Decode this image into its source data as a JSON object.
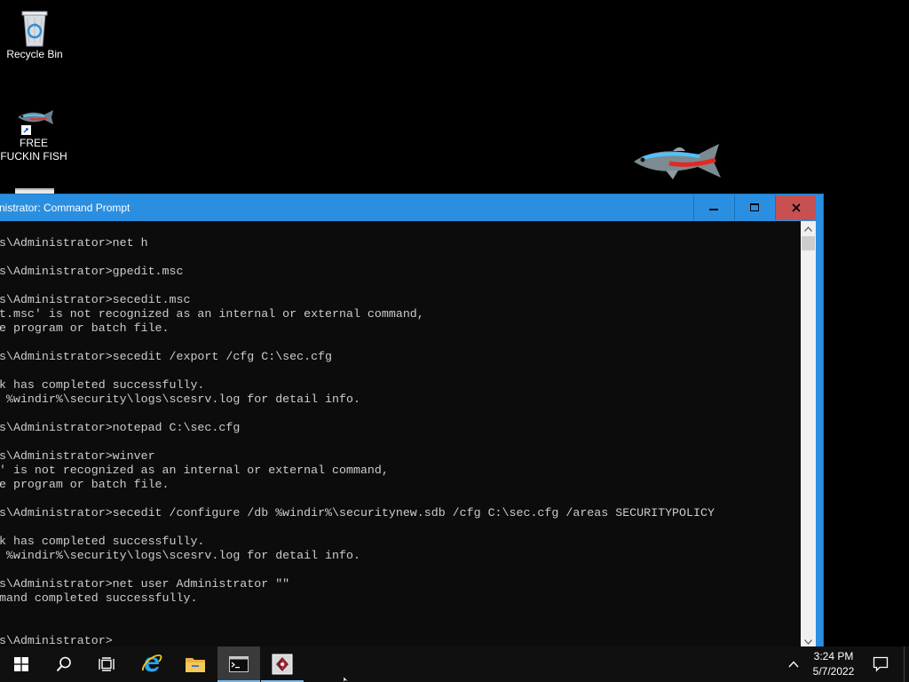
{
  "desktop": {
    "icons": [
      {
        "label": "Recycle Bin",
        "icon": "recycle-bin-icon"
      },
      {
        "label": "FREE FUCKIN FISH",
        "icon": "fish-shortcut-icon"
      }
    ]
  },
  "cmd_window": {
    "title": "nistrator: Command Prompt",
    "buttons": {
      "minimize": "minimize-icon",
      "maximize": "maximize-icon",
      "close": "close-icon"
    },
    "lines": [
      "s\\Administrator>net h",
      "",
      "s\\Administrator>gpedit.msc",
      "",
      "s\\Administrator>secedit.msc",
      "t.msc' is not recognized as an internal or external command,",
      "e program or batch file.",
      "",
      "s\\Administrator>secedit /export /cfg C:\\sec.cfg",
      "",
      "k has completed successfully.",
      " %windir%\\security\\logs\\scesrv.log for detail info.",
      "",
      "s\\Administrator>notepad C:\\sec.cfg",
      "",
      "s\\Administrator>winver",
      "' is not recognized as an internal or external command,",
      "e program or batch file.",
      "",
      "s\\Administrator>secedit /configure /db %windir%\\securitynew.sdb /cfg C:\\sec.cfg /areas SECURITYPOLICY",
      "",
      "k has completed successfully.",
      " %windir%\\security\\logs\\scesrv.log for detail info.",
      "",
      "s\\Administrator>net user Administrator \"\"",
      "mand completed successfully.",
      "",
      "",
      "s\\Administrator>"
    ]
  },
  "taskbar": {
    "items": [
      "start-icon",
      "search-icon",
      "task-view-icon",
      "internet-explorer-icon",
      "file-explorer-icon",
      "command-prompt-icon",
      "app-icon"
    ],
    "clock": {
      "time": "3:24 PM",
      "date": "5/7/2022"
    }
  },
  "colors": {
    "titlebar": "#2a8fe1",
    "close": "#c75050",
    "console_bg": "#0c0c0c",
    "console_fg": "#cccccc",
    "taskbar": "#101010"
  }
}
